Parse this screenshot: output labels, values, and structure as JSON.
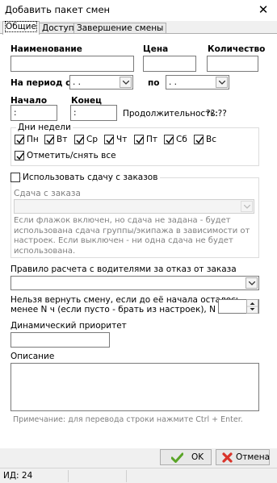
{
  "window": {
    "title": "Добавить пакет смен",
    "close_glyph": "✕"
  },
  "tabs": [
    {
      "label": "Общие",
      "active": true
    },
    {
      "label": "Доступ",
      "active": false
    },
    {
      "label": "Завершение смены",
      "active": false
    }
  ],
  "form": {
    "name_label": "Наименование",
    "name_value": "",
    "price_label": "Цена",
    "price_value": "",
    "qty_label": "Количество",
    "qty_value": "",
    "period_from_label": "На период с",
    "period_from_value": " . .",
    "period_to_label": "по",
    "period_to_value": " . .",
    "start_label": "Начало",
    "start_value": ":",
    "end_label": "Конец",
    "end_value": ":",
    "duration_label": "Продолжительность:",
    "duration_value": "??:??"
  },
  "weekdays": {
    "group_label": "Дни недели",
    "days": [
      {
        "label": "Пн",
        "checked": true
      },
      {
        "label": "Вт",
        "checked": true
      },
      {
        "label": "Ср",
        "checked": true
      },
      {
        "label": "Чт",
        "checked": true
      },
      {
        "label": "Пт",
        "checked": true
      },
      {
        "label": "Сб",
        "checked": true
      },
      {
        "label": "Вс",
        "checked": true
      }
    ],
    "toggle_all_label": "Отметить/снять все",
    "toggle_all_checked": true
  },
  "change": {
    "use_label": "Использовать сдачу с заказов",
    "use_checked": false,
    "combo_label": "Сдача с заказа",
    "combo_value": "",
    "hint": "Если флажок включен, но сдача не задана - будет использована сдача группы/экипажа в зависимости от настроек. Если выключен - ни одна сдача не будет использована."
  },
  "driver_rule": {
    "label": "Правило расчета с водителями за отказ от заказа",
    "value": ""
  },
  "return_rule": {
    "label_line1": "Нельзя вернуть смену, если до её начала осталось",
    "label_line2": "менее N ч (если пусто - брать из настроек), N =",
    "value": ""
  },
  "priority": {
    "label": "Динамический приоритет",
    "value": ""
  },
  "description": {
    "label": "Описание",
    "value": "",
    "note": "Примечание: для перевода строки нажмите Ctrl + Enter."
  },
  "buttons": {
    "ok_label": "OK",
    "cancel_label": "Отмена"
  },
  "status": {
    "id_text": "ИД: 24"
  },
  "colors": {
    "check_green": "#5aa528",
    "cancel_red": "#d9342b"
  },
  "icons": {
    "ok": "green-checkmark-icon",
    "cancel": "red-cross-icon"
  }
}
